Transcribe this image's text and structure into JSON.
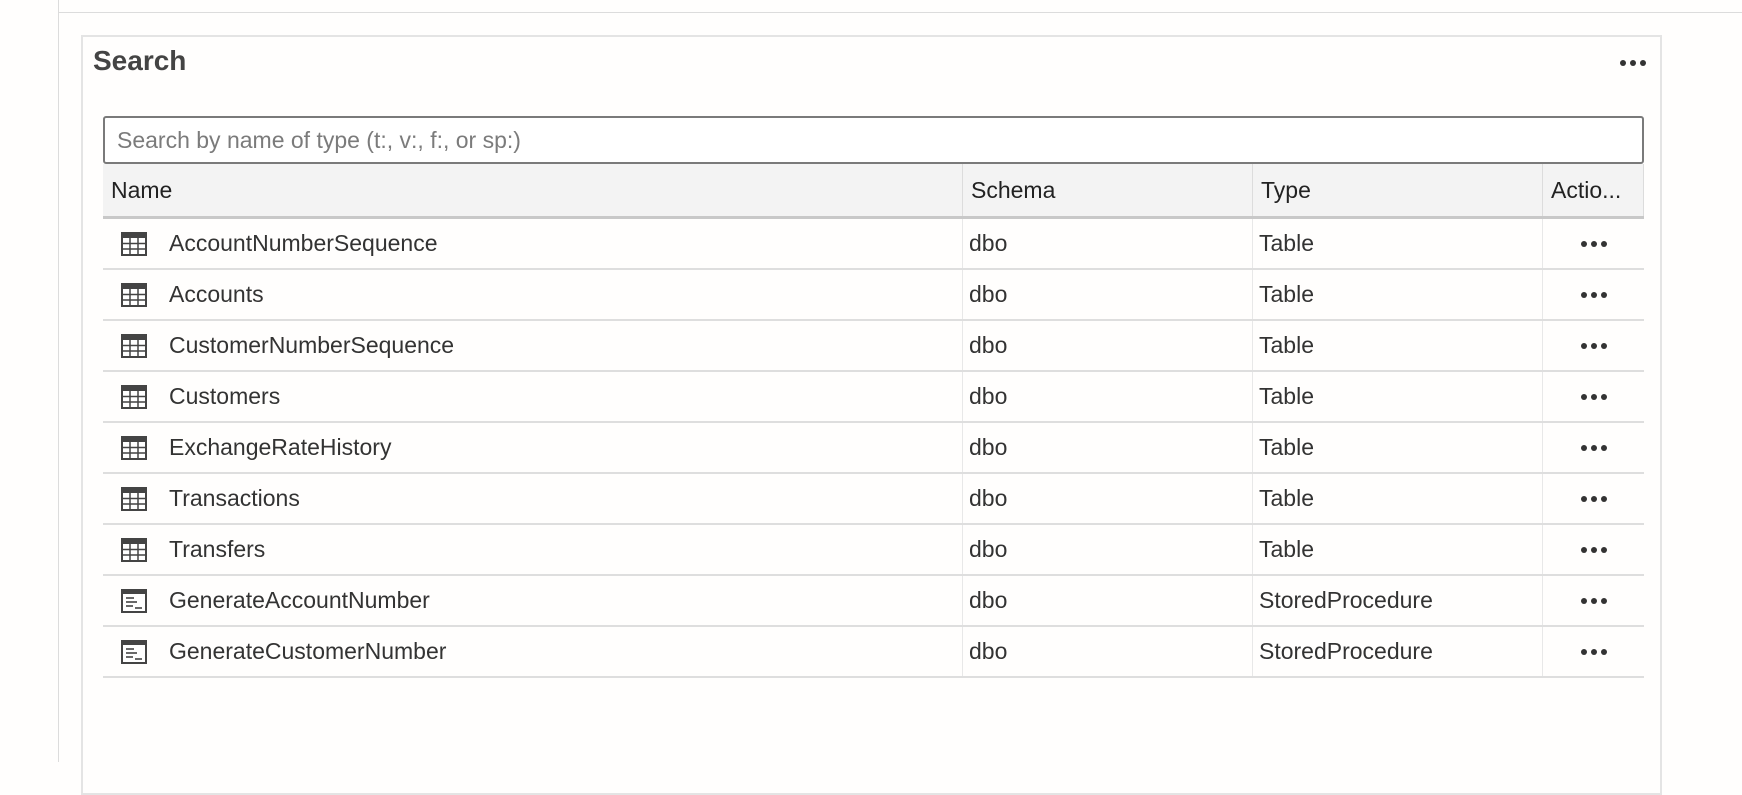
{
  "panel": {
    "title": "Search",
    "menu_icon": "more-horizontal-icon"
  },
  "search": {
    "placeholder": "Search by name of type (t:, v:, f:, or sp:)",
    "value": ""
  },
  "grid": {
    "columns": [
      "Name",
      "Schema",
      "Type",
      "Actio..."
    ],
    "rows": [
      {
        "icon": "table-icon",
        "name": "AccountNumberSequence",
        "schema": "dbo",
        "type": "Table"
      },
      {
        "icon": "table-icon",
        "name": "Accounts",
        "schema": "dbo",
        "type": "Table"
      },
      {
        "icon": "table-icon",
        "name": "CustomerNumberSequence",
        "schema": "dbo",
        "type": "Table"
      },
      {
        "icon": "table-icon",
        "name": "Customers",
        "schema": "dbo",
        "type": "Table"
      },
      {
        "icon": "table-icon",
        "name": "ExchangeRateHistory",
        "schema": "dbo",
        "type": "Table"
      },
      {
        "icon": "table-icon",
        "name": "Transactions",
        "schema": "dbo",
        "type": "Table"
      },
      {
        "icon": "table-icon",
        "name": "Transfers",
        "schema": "dbo",
        "type": "Table"
      },
      {
        "icon": "stored-procedure-icon",
        "name": "GenerateAccountNumber",
        "schema": "dbo",
        "type": "StoredProcedure"
      },
      {
        "icon": "stored-procedure-icon",
        "name": "GenerateCustomerNumber",
        "schema": "dbo",
        "type": "StoredProcedure"
      }
    ]
  },
  "colors": {
    "header_bg": "#f3f3f3",
    "border": "#dedede",
    "text": "#333333"
  }
}
